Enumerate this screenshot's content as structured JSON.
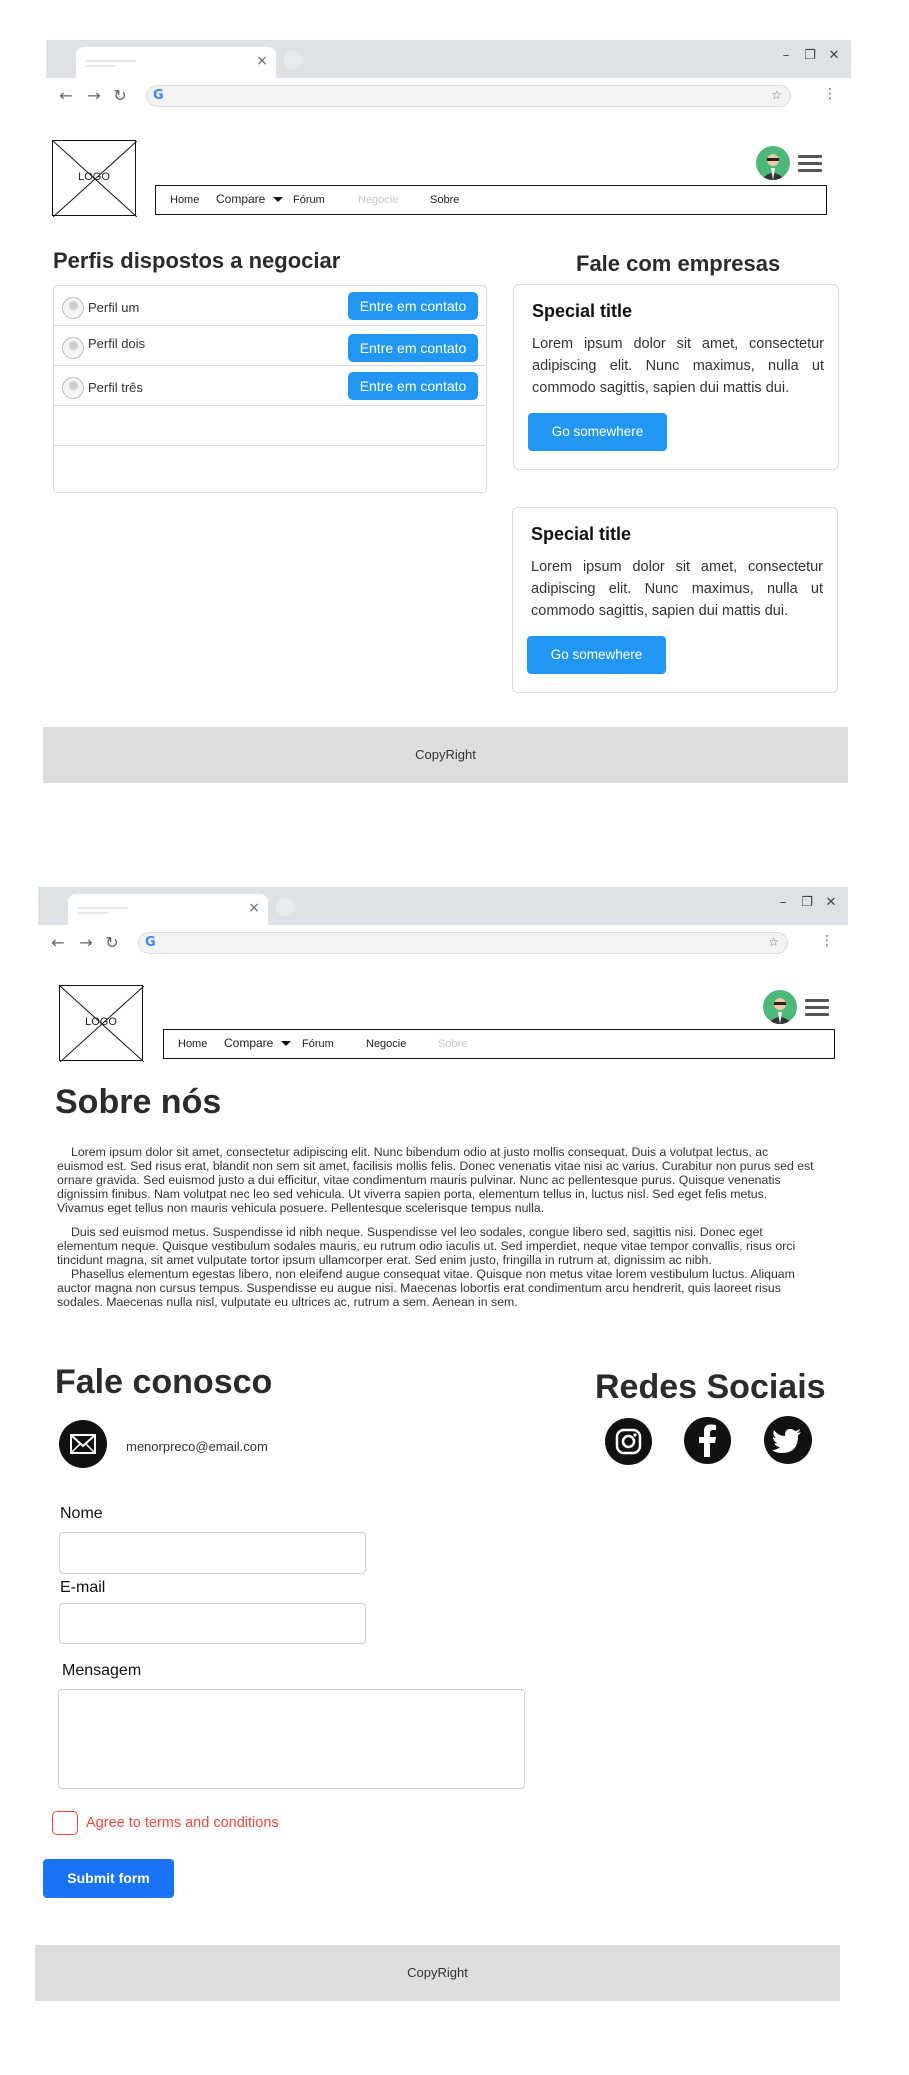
{
  "page1": {
    "header": {
      "logo_text": "LOGO",
      "nav": {
        "home": "Home",
        "compare": "Compare",
        "forum": "Fórum",
        "negotiate": "Negocie",
        "about": "Sobre"
      }
    },
    "profiles": {
      "title": "Perfis dispostos a negociar",
      "items": [
        {
          "name": "Perfil um",
          "action": "Entre em contato"
        },
        {
          "name": "Perfil dois",
          "action": "Entre em contato"
        },
        {
          "name": "Perfil três",
          "action": "Entre em contato"
        }
      ]
    },
    "companies": {
      "title": "Fale com empresas",
      "cards": [
        {
          "title": "Special title",
          "text": "Lorem ipsum dolor sit amet, consectetur adipiscing elit. Nunc maximus, nulla ut commodo sagittis, sapien dui mattis dui.",
          "button": "Go somewhere"
        },
        {
          "title": "Special title",
          "text": "Lorem ipsum dolor sit amet, consectetur adipiscing elit. Nunc maximus, nulla ut commodo sagittis, sapien dui mattis dui.",
          "button": "Go somewhere"
        }
      ]
    },
    "footer": "CopyRight"
  },
  "page2": {
    "header": {
      "logo_text": "LOGO",
      "nav": {
        "home": "Home",
        "compare": "Compare",
        "forum": "Fórum",
        "negotiate": "Negocie",
        "about": "Sobre"
      }
    },
    "about": {
      "title": "Sobre nós",
      "paragraphs": [
        "Lorem ipsum dolor sit amet, consectetur adipiscing elit. Nunc bibendum odio at justo mollis consequat. Duis a volutpat lectus, ac euismod est. Sed risus erat, blandit non sem sit amet, facilisis mollis felis. Donec venenatis vitae nisi ac varius. Curabitur non purus sed est ornare gravida. Sed euismod justo a dui efficitur, vitae condimentum mauris pulvinar. Nunc ac pellentesque purus. Quisque venenatis dignissim finibus. Nam volutpat nec leo sed vehicula. Ut viverra sapien porta, elementum tellus in, luctus nisl. Sed eget felis metus. Vivamus eget tellus non mauris vehicula posuere. Pellentesque scelerisque tempus nulla.",
        "Duis sed euismod metus. Suspendisse id nibh neque. Suspendisse vel leo sodales, congue libero sed, sagittis nisi. Donec eget elementum neque. Quisque vestibulum sodales mauris, eu rutrum odio iaculis ut. Sed imperdiet, neque vitae tempor convallis, risus orci tincidunt magna, sit amet vulputate tortor ipsum ullamcorper erat. Sed enim justo, fringilla in rutrum at, dignissim ac nibh.",
        "Phasellus elementum egestas libero, non eleifend augue consequat vitae. Quisque non metus vitae lorem vestibulum luctus. Aliquam auctor magna non cursus tempus. Suspendisse eu augue nisi. Maecenas lobortis erat condimentum arcu hendrerit, quis laoreet risus sodales. Maecenas nulla nisl, vulputate eu ultrices ac, rutrum a sem. Aenean in sem."
      ]
    },
    "contact": {
      "title": "Fale conosco",
      "email": "menorpreco@email.com",
      "labels": {
        "name": "Nome",
        "email": "E-mail",
        "message": "Mensagem"
      },
      "agree": "Agree to terms and conditions",
      "submit": "Submit form"
    },
    "social": {
      "title": "Redes Sociais",
      "icons": [
        "instagram-icon",
        "facebook-icon",
        "twitter-icon"
      ]
    },
    "footer": "CopyRight"
  },
  "colors": {
    "primary_button": "#2196f3",
    "submit_button": "#1874f5",
    "error_red": "#e74c3c",
    "footer_bg": "#dedede",
    "chrome_bg": "#dee1e6"
  }
}
